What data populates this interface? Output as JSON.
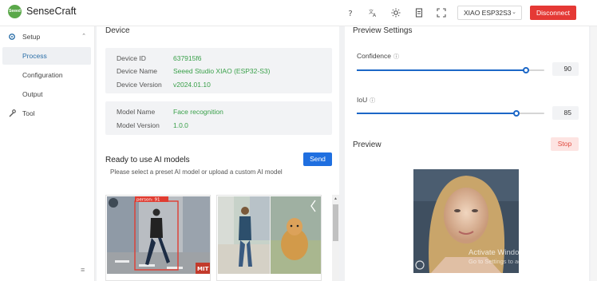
{
  "app": {
    "logo_text": "Seeed Studio",
    "title": "SenseCraft"
  },
  "header": {
    "icons": [
      "help-icon",
      "translate-icon",
      "theme-icon",
      "document-icon",
      "fullscreen-icon"
    ],
    "device_select": "XIAO ESP32S3",
    "disconnect_label": "Disconnect"
  },
  "sidebar": {
    "setup_label": "Setup",
    "items": [
      {
        "label": "Process",
        "active": true
      },
      {
        "label": "Configuration",
        "active": false
      },
      {
        "label": "Output",
        "active": false
      }
    ],
    "tool_label": "Tool"
  },
  "device": {
    "title": "Device",
    "id_label": "Device ID",
    "id_value": "637915f6",
    "name_label": "Device Name",
    "name_value": "Seeed Studio XIAO (ESP32-S3)",
    "version_label": "Device Version",
    "version_value": "v2024.01.10"
  },
  "model": {
    "name_label": "Model Name",
    "name_value": "Face recognition",
    "version_label": "Model Version",
    "version_value": "1.0.0"
  },
  "ready": {
    "title": "Ready to use AI models",
    "subtitle": "Please select a preset AI model or upload a custom AI model",
    "send_label": "Send",
    "detection_label": "person: 91",
    "badge": "MIT"
  },
  "preview_settings": {
    "title": "Preview Settings",
    "confidence_label": "Confidence",
    "confidence_value": "90",
    "confidence_fraction": 0.9,
    "iou_label": "IoU",
    "iou_value": "85",
    "iou_fraction": 0.85
  },
  "preview": {
    "title": "Preview",
    "stop_label": "Stop",
    "watermark_title": "Activate Windows",
    "watermark_sub": "Go to Settings to activate Windows."
  },
  "colors": {
    "accent": "#1c67c7",
    "danger": "#e53935",
    "value_green": "#3aa04a"
  }
}
